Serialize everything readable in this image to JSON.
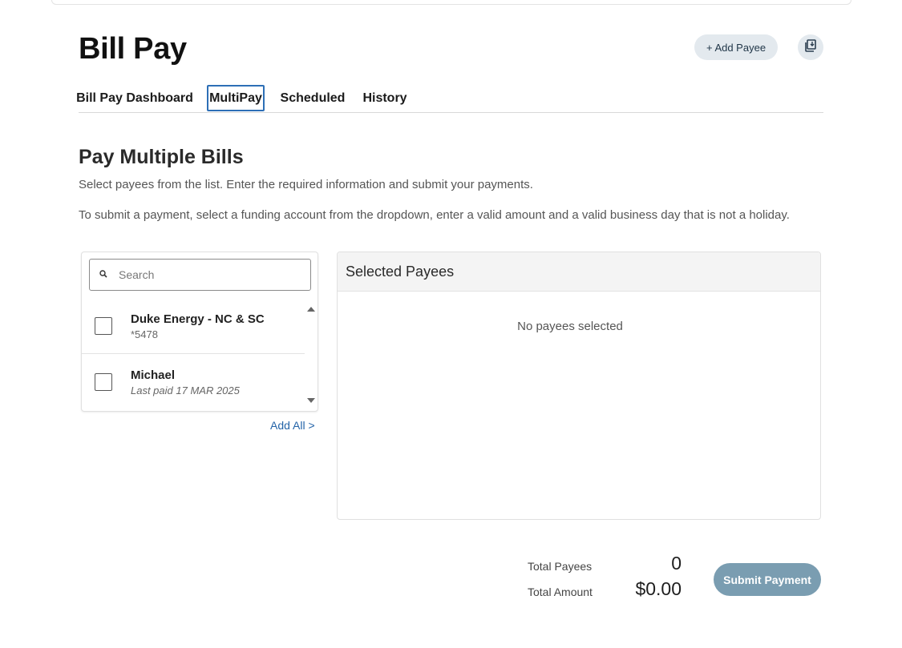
{
  "header": {
    "title": "Bill Pay",
    "add_payee_label": "+ Add Payee",
    "print_icon": "print-document-icon"
  },
  "tabs": [
    {
      "label": "Bill Pay Dashboard",
      "active": false
    },
    {
      "label": "MultiPay",
      "active": true
    },
    {
      "label": "Scheduled",
      "active": false
    },
    {
      "label": "History",
      "active": false
    }
  ],
  "section": {
    "title": "Pay Multiple Bills",
    "description": "Select payees from the list. Enter the required information and submit your payments.",
    "instructions": "To submit a payment, select a funding account from the dropdown, enter a valid amount and a valid business day that is not a holiday."
  },
  "payee_list": {
    "search_placeholder": "Search",
    "items": [
      {
        "name": "Duke Energy - NC & SC",
        "detail": "*5478",
        "checked": false
      },
      {
        "name": "Michael",
        "detail": "Last paid 17 MAR 2025",
        "checked": false
      }
    ],
    "add_all_label": "Add All >"
  },
  "selected_payees": {
    "title": "Selected Payees",
    "empty_message": "No payees selected"
  },
  "totals": {
    "payees_label": "Total Payees",
    "payees_value": "0",
    "amount_label": "Total Amount",
    "amount_value": "$0.00"
  },
  "submit_label": "Submit Payment",
  "colors": {
    "accent": "#2d6fb6",
    "link": "#2464a8",
    "submit_disabled": "#7a9db1",
    "pill_bg": "#e3e9ee"
  }
}
